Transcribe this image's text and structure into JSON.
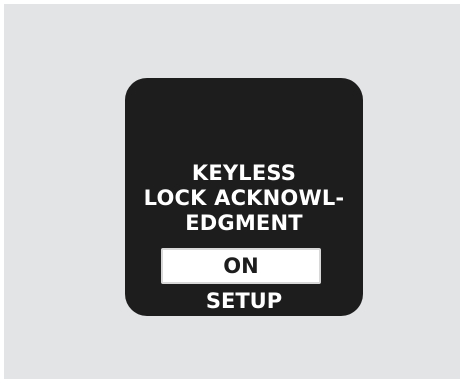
{
  "display": {
    "title_lines": [
      "KEYLESS",
      "LOCK ACKNOWL-",
      "EDGMENT"
    ],
    "selected_value": "ON",
    "footer_label": "SETUP"
  },
  "colors": {
    "background_panel": "#e3e4e6",
    "screen": "#1d1d1d",
    "text": "#ffffff",
    "selection_box": "#ffffff"
  }
}
